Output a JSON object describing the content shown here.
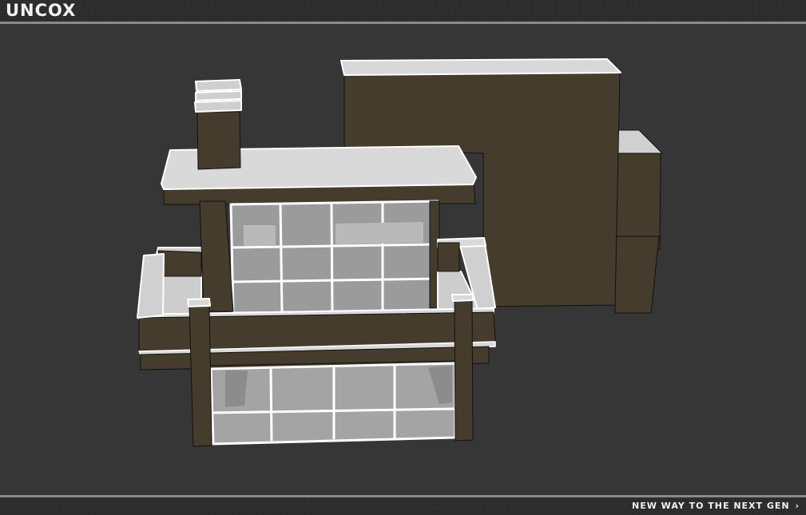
{
  "app": {
    "logo_text": "UNCOX"
  },
  "footer": {
    "link_text": "NEW WAY TO THE NEXT GEN",
    "chevron_glyph": "›"
  },
  "colors": {
    "background": "#363636",
    "bar": "#2a2a2a",
    "bar_border": "#8a8a8a",
    "wall": "#463c2d",
    "roof": "#d8d8d8",
    "glass": "#a9a9a9",
    "outline": "#ffffff"
  }
}
